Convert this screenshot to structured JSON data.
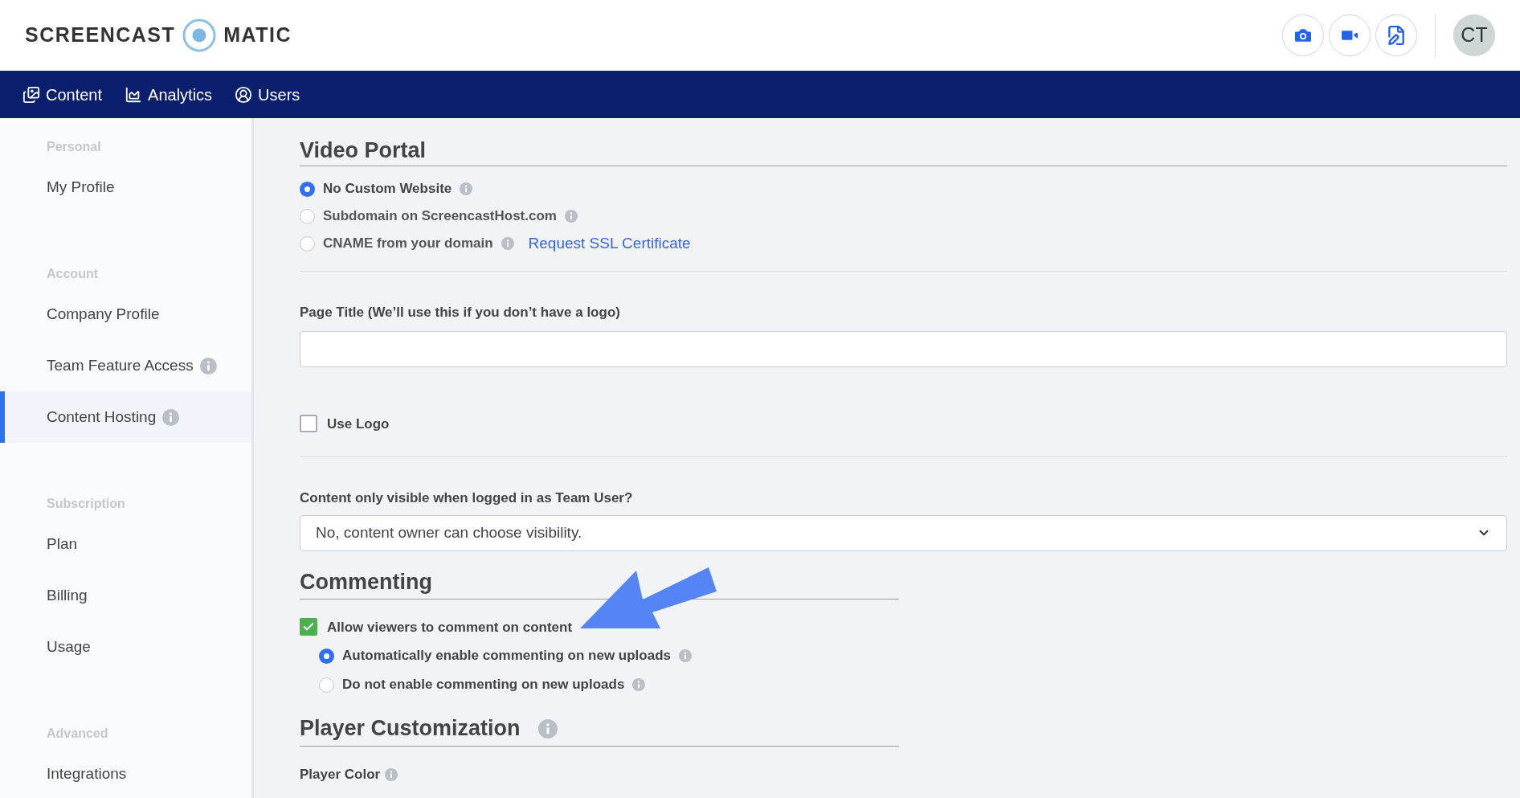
{
  "header": {
    "logo_left": "SCREENCAST",
    "logo_right": "MATIC",
    "tools": [
      {
        "kind": "camera"
      },
      {
        "kind": "video"
      },
      {
        "kind": "edit"
      }
    ],
    "avatar": "CT"
  },
  "nav": [
    {
      "label": "Content",
      "kind": "content"
    },
    {
      "label": "Analytics",
      "kind": "analytics"
    },
    {
      "label": "Users",
      "kind": "users"
    }
  ],
  "sidebar": [
    {
      "heading": "Personal",
      "items": [
        {
          "label": "My Profile",
          "info": false,
          "selected": false
        }
      ]
    },
    {
      "heading": "Account",
      "items": [
        {
          "label": "Company Profile",
          "info": false,
          "selected": false
        },
        {
          "label": "Team Feature Access",
          "info": true,
          "selected": false
        },
        {
          "label": "Content Hosting",
          "info": true,
          "selected": true
        }
      ]
    },
    {
      "heading": "Subscription",
      "items": [
        {
          "label": "Plan",
          "info": false,
          "selected": false
        },
        {
          "label": "Billing",
          "info": false,
          "selected": false
        },
        {
          "label": "Usage",
          "info": false,
          "selected": false
        }
      ]
    },
    {
      "heading": "Advanced",
      "items": [
        {
          "label": "Integrations",
          "info": false,
          "selected": false
        }
      ]
    }
  ],
  "video_portal": {
    "title": "Video Portal",
    "options": [
      {
        "label": "No Custom Website",
        "info": true,
        "selected": true
      },
      {
        "label": "Subdomain on ScreencastHost.com",
        "info": true,
        "selected": false
      },
      {
        "label": "CNAME from your domain",
        "info": true,
        "selected": false,
        "link": "Request SSL Certificate"
      }
    ],
    "page_title_label": "Page Title (We’ll use this if you don’t have a logo)",
    "use_logo": {
      "label": "Use Logo",
      "checked": false
    },
    "visibility_label": "Content only visible when logged in as Team User?",
    "visibility_value": "No, content owner can choose visibility."
  },
  "commenting": {
    "title": "Commenting",
    "allow": {
      "label": "Allow viewers to comment on content",
      "checked": true
    },
    "options": [
      {
        "label": "Automatically enable commenting on new uploads",
        "info": true,
        "selected": true
      },
      {
        "label": "Do not enable commenting on new uploads",
        "info": true,
        "selected": false
      }
    ]
  },
  "player": {
    "title": "Player Customization",
    "info": true,
    "color_label": "Player Color",
    "color_info": true
  }
}
